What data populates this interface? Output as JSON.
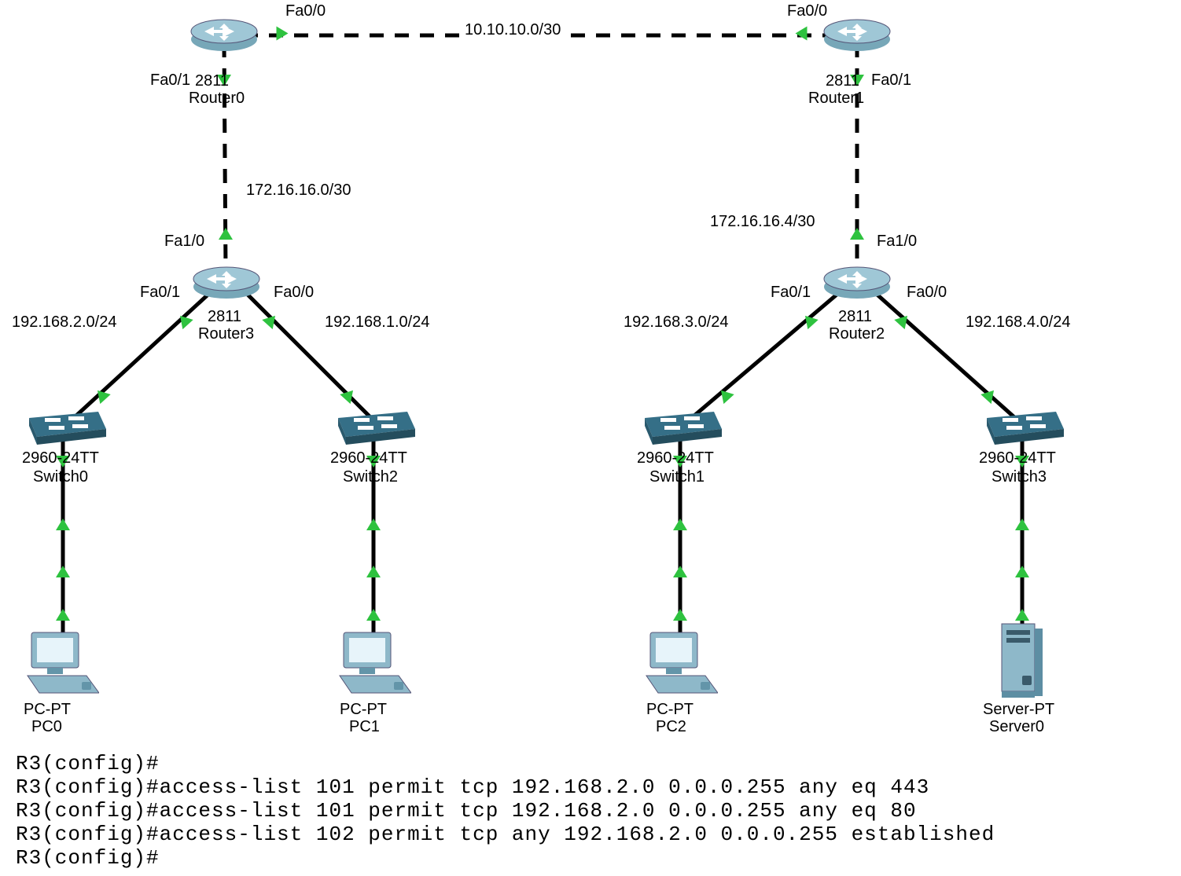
{
  "network": {
    "subnets": {
      "top_link": "10.10.10.0/30",
      "left_mid": "172.16.16.0/30",
      "right_mid": "172.16.16.4/30",
      "lan_left_a": "192.168.2.0/24",
      "lan_left_b": "192.168.1.0/24",
      "lan_right_a": "192.168.3.0/24",
      "lan_right_b": "192.168.4.0/24"
    },
    "ports": {
      "r0_top": "Fa0/0",
      "r0_side": "Fa0/1",
      "r1_top": "Fa0/0",
      "r1_side": "Fa0/1",
      "r3_top": "Fa1/0",
      "r3_left": "Fa0/1",
      "r3_right": "Fa0/0",
      "r2_top": "Fa1/0",
      "r2_left": "Fa0/1",
      "r2_right": "Fa0/0"
    },
    "devices": {
      "router0": {
        "model": "2811",
        "name": "Router0"
      },
      "router1": {
        "model": "2811",
        "name": "Router1"
      },
      "router3": {
        "model": "2811",
        "name": "Router3"
      },
      "router2": {
        "model": "2811",
        "name": "Router2"
      },
      "switch0": {
        "model": "2960-24TT",
        "name": "Switch0"
      },
      "switch2": {
        "model": "2960-24TT",
        "name": "Switch2"
      },
      "switch1": {
        "model": "2960-24TT",
        "name": "Switch1"
      },
      "switch3": {
        "model": "2960-24TT",
        "name": "Switch3"
      },
      "pc0": {
        "model": "PC-PT",
        "name": "PC0"
      },
      "pc1": {
        "model": "PC-PT",
        "name": "PC1"
      },
      "pc2": {
        "model": "PC-PT",
        "name": "PC2"
      },
      "server0": {
        "model": "Server-PT",
        "name": "Server0"
      }
    }
  },
  "cli": {
    "lines": [
      "R3(config)#",
      "R3(config)#access-list 101 permit tcp 192.168.2.0 0.0.0.255 any eq 443",
      "R3(config)#access-list 101 permit tcp 192.168.2.0 0.0.0.255 any eq 80",
      "R3(config)#access-list 102 permit tcp any 192.168.2.0 0.0.0.255 established",
      "R3(config)#"
    ]
  }
}
